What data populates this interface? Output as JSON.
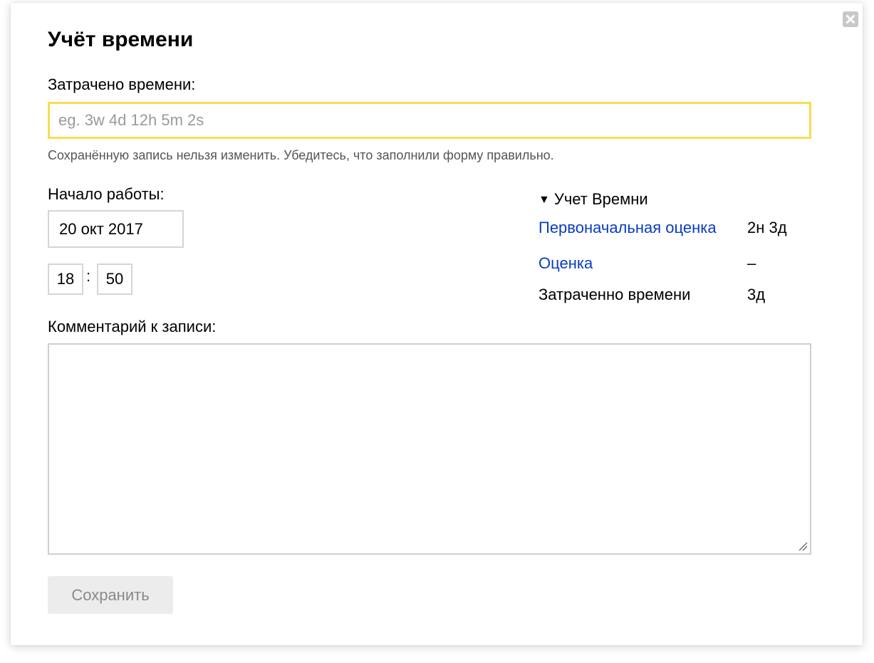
{
  "dialog": {
    "title": "Учёт времени",
    "close_icon": "close-icon"
  },
  "time_spent": {
    "label": "Затрачено времени:",
    "placeholder": "eg. 3w 4d 12h 5m 2s",
    "value": "",
    "hint": "Сохранённую запись нельзя изменить. Убедитесь, что заполнили форму правильно.",
    "focus_color": "#f7dc53"
  },
  "start": {
    "label": "Начало работы:",
    "date": "20 окт 2017",
    "hour": "18",
    "separator": ":",
    "minute": "50"
  },
  "comment": {
    "label": "Комментарий к записи:",
    "value": ""
  },
  "save_button": {
    "label": "Сохранить"
  },
  "side_panel": {
    "toggle_icon": "triangle-down-icon",
    "title": "Учет Времни",
    "link_color": "#0a3cc2",
    "rows": [
      {
        "label": "Первоначальная оценка",
        "value": "2н 3д",
        "is_link": true
      },
      {
        "label": "Оценка",
        "value": "–",
        "is_link": true
      },
      {
        "label": "Затраченно времени",
        "value": "3д",
        "is_link": false
      }
    ]
  }
}
